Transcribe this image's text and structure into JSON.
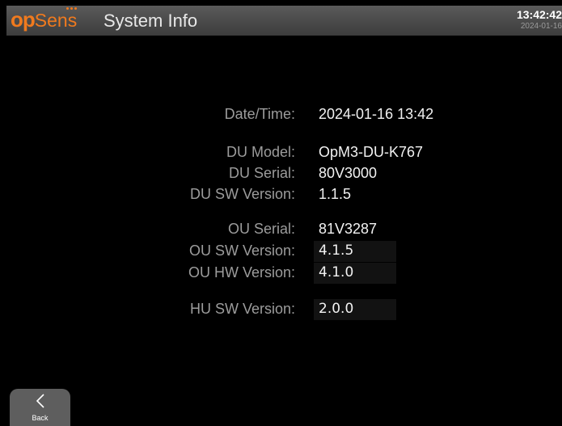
{
  "header": {
    "logo_op": "op",
    "logo_sens": "Sens",
    "title": "System Info",
    "time": "13:42:42",
    "date": "2024-01-16"
  },
  "info": {
    "datetime": {
      "label": "Date/Time:",
      "value": "2024-01-16  13:42"
    },
    "du_model": {
      "label": "DU Model:",
      "value": "OpM3-DU-K767"
    },
    "du_serial": {
      "label": "DU Serial:",
      "value": "80V3000"
    },
    "du_sw_version": {
      "label": "DU SW Version:",
      "value": "1.1.5"
    },
    "ou_serial": {
      "label": "OU Serial:",
      "value": "81V3287"
    },
    "ou_sw_version": {
      "label": "OU SW Version:",
      "value": "4.1.5"
    },
    "ou_hw_version": {
      "label": "OU HW Version:",
      "value": "4.1.0"
    },
    "hu_sw_version": {
      "label": "HU SW Version:",
      "value": "2.0.0"
    }
  },
  "footer": {
    "back_label": "Back",
    "back_icon": "chevron-left-icon"
  },
  "colors": {
    "brand": "#f07a1e",
    "label": "#9c9c9c",
    "value": "#f2f2f2",
    "header_bg": "#4a4a4a",
    "button_bg": "#5e5e5e"
  }
}
